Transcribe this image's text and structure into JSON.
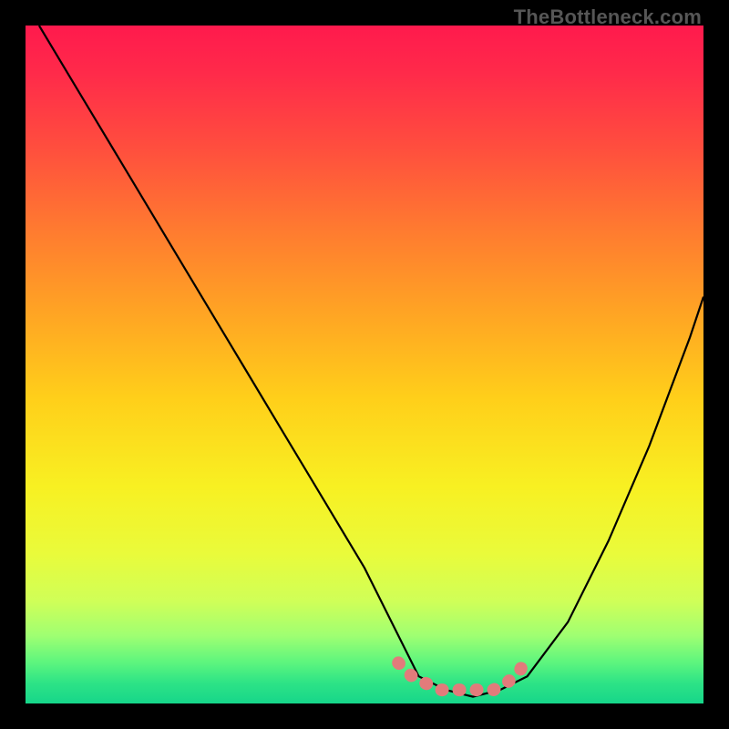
{
  "watermark": "TheBottleneck.com",
  "chart_data": {
    "type": "line",
    "title": "",
    "xlabel": "",
    "ylabel": "",
    "xlim": [
      0,
      100
    ],
    "ylim": [
      0,
      100
    ],
    "grid": false,
    "series": [
      {
        "name": "bottleneck-curve",
        "x": [
          2,
          8,
          14,
          20,
          26,
          32,
          38,
          44,
          50,
          55,
          58,
          62,
          66,
          70,
          74,
          80,
          86,
          92,
          98,
          100
        ],
        "y": [
          100,
          90,
          80,
          70,
          60,
          50,
          40,
          30,
          20,
          10,
          4,
          2,
          1,
          2,
          4,
          12,
          24,
          38,
          54,
          60
        ]
      },
      {
        "name": "optimal-marker",
        "x": [
          55,
          57,
          59,
          61,
          63,
          65,
          67,
          69,
          71,
          73,
          74
        ],
        "y": [
          6,
          4,
          3,
          2,
          2,
          2,
          2,
          2,
          3,
          5,
          7
        ]
      }
    ],
    "gradient_stops": [
      {
        "offset": 0.0,
        "color": "#ff1a4d"
      },
      {
        "offset": 0.07,
        "color": "#ff2a4a"
      },
      {
        "offset": 0.18,
        "color": "#ff4e3e"
      },
      {
        "offset": 0.3,
        "color": "#ff7a30"
      },
      {
        "offset": 0.42,
        "color": "#ffa324"
      },
      {
        "offset": 0.55,
        "color": "#ffcf1a"
      },
      {
        "offset": 0.68,
        "color": "#f8f022"
      },
      {
        "offset": 0.78,
        "color": "#e9fb3b"
      },
      {
        "offset": 0.85,
        "color": "#cfff58"
      },
      {
        "offset": 0.9,
        "color": "#9fff72"
      },
      {
        "offset": 0.94,
        "color": "#5cf57e"
      },
      {
        "offset": 0.97,
        "color": "#2de386"
      },
      {
        "offset": 1.0,
        "color": "#16d68a"
      }
    ]
  }
}
